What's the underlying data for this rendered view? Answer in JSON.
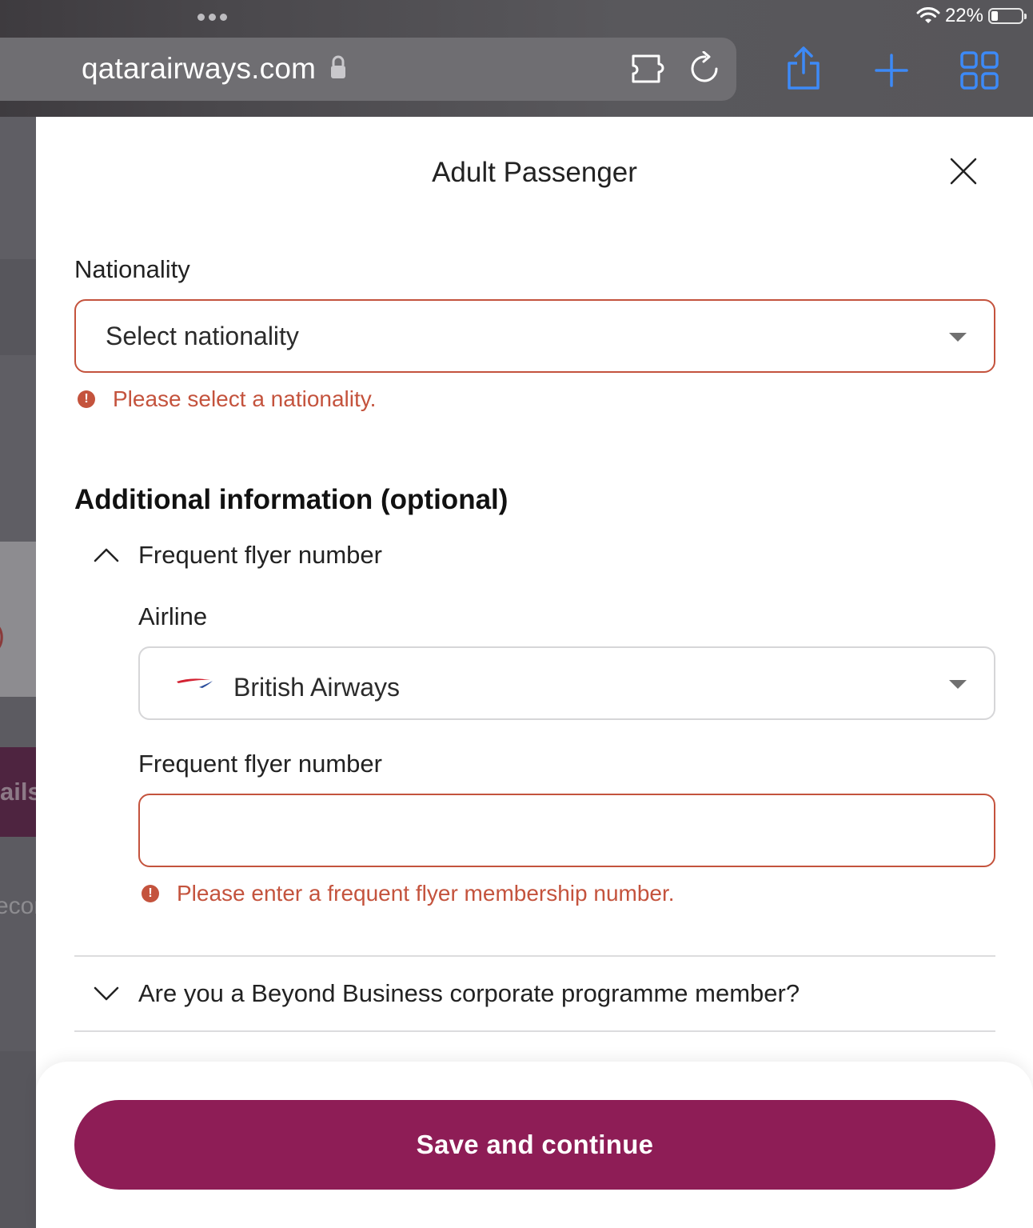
{
  "browser": {
    "url": "qatarairways.com",
    "battery": "22%",
    "battery_level": 0.22,
    "icons": {
      "lock": "lock-icon",
      "extension": "extension-icon",
      "reload": "reload-icon",
      "share": "share-icon",
      "new_tab": "plus-icon",
      "tabs": "tabs-grid-icon",
      "wifi": "wifi-icon"
    }
  },
  "background": {
    "fragment_1": ")",
    "fragment_2": "ails",
    "fragment_3": "ecor"
  },
  "modal": {
    "title": "Adult Passenger",
    "nationality": {
      "label": "Nationality",
      "placeholder": "Select nationality",
      "error": "Please select a nationality."
    },
    "additional": {
      "heading": "Additional information (optional)",
      "ffn_section": {
        "title": "Frequent flyer number",
        "airline_label": "Airline",
        "airline_value": "British Airways",
        "number_label": "Frequent flyer number",
        "number_value": "",
        "number_error": "Please enter a frequent flyer membership number."
      },
      "beyond_business": {
        "title": "Are you a Beyond Business corporate programme member?"
      }
    },
    "save_label": "Save and continue"
  },
  "colors": {
    "accent": "#8e1d56",
    "error": "#c4533d",
    "browser_blue": "#3d8af7"
  }
}
